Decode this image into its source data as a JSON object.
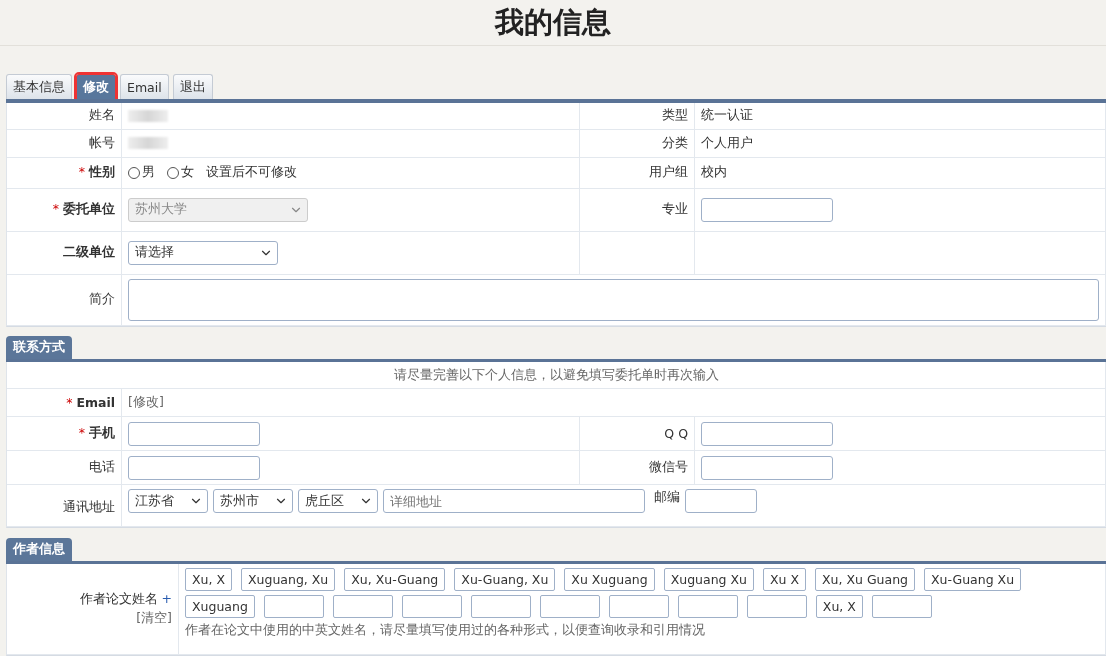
{
  "title": "我的信息",
  "tabs": [
    {
      "label": "基本信息",
      "selected": false
    },
    {
      "label": "修改",
      "selected": true
    },
    {
      "label": "Email",
      "selected": false
    },
    {
      "label": "退出",
      "selected": false
    }
  ],
  "basic": {
    "rows": [
      {
        "left": {
          "label": "姓名",
          "strong": false,
          "kind": "redacted"
        },
        "right": {
          "label": "类型",
          "kind": "text",
          "value": "统一认证"
        }
      },
      {
        "left": {
          "label": "帐号",
          "strong": false,
          "kind": "redacted"
        },
        "right": {
          "label": "分类",
          "kind": "text",
          "value": "个人用户"
        }
      },
      {
        "left": {
          "star": "*",
          "label": "性别",
          "strong": true,
          "kind": "radio",
          "options": [
            {
              "label": "男",
              "checked": false
            },
            {
              "label": "女",
              "checked": false
            }
          ],
          "note": "设置后不可修改"
        },
        "right": {
          "label": "用户组",
          "kind": "text",
          "value": "校内"
        }
      },
      {
        "left": {
          "star": "*",
          "label": "委托单位",
          "strong": true,
          "kind": "select",
          "value": "苏州大学",
          "disabled": true
        },
        "right": {
          "label": "专业",
          "kind": "input"
        }
      },
      {
        "left": {
          "label": "二级单位",
          "strong": true,
          "kind": "select",
          "value": "请选择",
          "disabled": false
        },
        "right": {
          "kind": "empty"
        }
      },
      {
        "left": {
          "label": "简介",
          "strong": false,
          "kind": "textarea"
        }
      }
    ]
  },
  "contact": {
    "heading": "联系方式",
    "note": "请尽量完善以下个人信息，以避免填写委托单时再次输入",
    "email": {
      "star": "*",
      "label": "Email",
      "strong": true,
      "link": "[修改]"
    },
    "rows": [
      {
        "left": {
          "star": "*",
          "label": "手机",
          "strong": true
        },
        "right": {
          "label": "Q Q"
        }
      },
      {
        "left": {
          "label": "电话",
          "strong": false
        },
        "right": {
          "label": "微信号"
        }
      }
    ],
    "address": {
      "label": "通讯地址",
      "selects": [
        "江苏省",
        "苏州市",
        "虎丘区"
      ],
      "placeholder": "详细地址",
      "zip_label": "邮编"
    }
  },
  "author": {
    "heading": "作者信息",
    "label": "作者论文姓名",
    "add": "+",
    "clear": "[清空]",
    "name_rows": [
      [
        "Xu, X",
        "Xuguang, Xu",
        "Xu, Xu-Guang",
        "Xu-Guang, Xu",
        "Xu Xuguang",
        "Xuguang Xu",
        "Xu X",
        "Xu, Xu Guang",
        "Xu-Guang Xu"
      ],
      [
        "Xuguang",
        "",
        "",
        "",
        "",
        "",
        "",
        "",
        "",
        "Xu, X",
        ""
      ]
    ],
    "hint": "作者在论文中使用的中英文姓名，请尽量填写使用过的各种形式，以便查询收录和引用情况"
  }
}
